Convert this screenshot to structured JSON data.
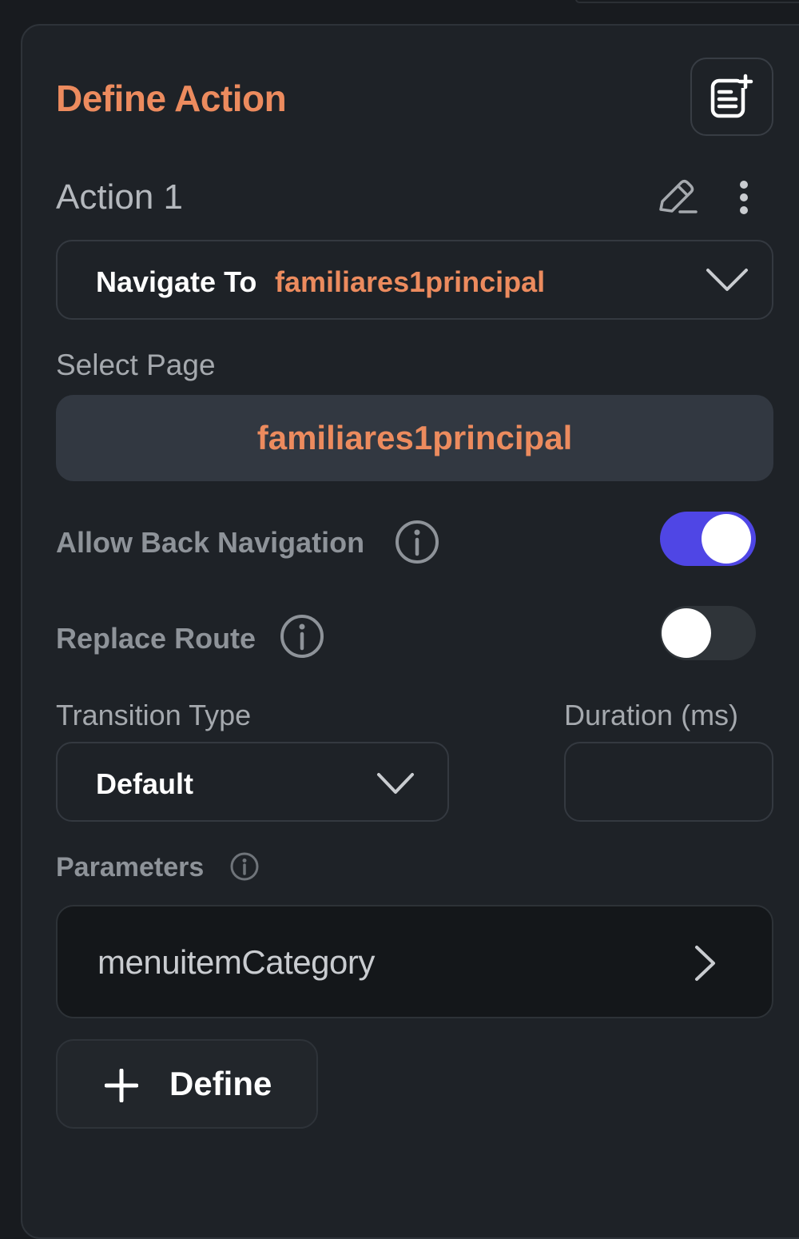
{
  "panel": {
    "title": "Define Action",
    "note_icon": "note-add-icon"
  },
  "action": {
    "name": "Action 1",
    "edit_icon": "pencil-icon",
    "more_icon": "more-vertical-icon",
    "type_label": "Navigate To",
    "type_value": "familiares1principal"
  },
  "select_page": {
    "label": "Select Page",
    "value": "familiares1principal"
  },
  "allow_back_navigation": {
    "label": "Allow Back Navigation",
    "enabled": true
  },
  "replace_route": {
    "label": "Replace Route",
    "enabled": false
  },
  "transition": {
    "type_label": "Transition Type",
    "type_value": "Default",
    "duration_label": "Duration (ms)",
    "duration_value": ""
  },
  "parameters": {
    "label": "Parameters",
    "items": [
      "menuitemCategory"
    ],
    "define_label": "Define"
  },
  "colors": {
    "accent": "#ec8b5e",
    "toggle_on": "#4f46e5",
    "panel_bg": "#1e2227"
  }
}
